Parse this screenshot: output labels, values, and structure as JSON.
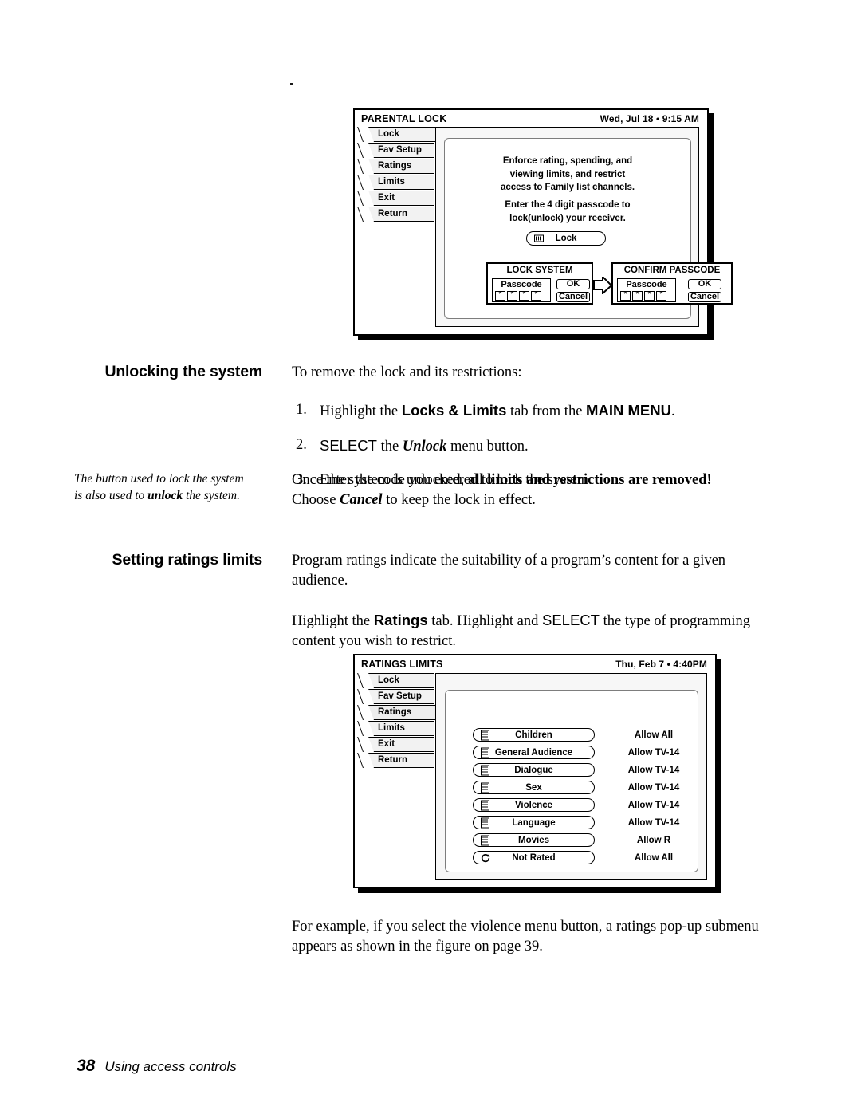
{
  "page": {
    "number": "38",
    "footer_text": "Using access controls"
  },
  "figure1": {
    "title": "PARENTAL LOCK",
    "clock": "Wed, Jul 18 • 9:15 AM",
    "tabs": [
      {
        "label": "Lock"
      },
      {
        "label": "Fav Setup"
      },
      {
        "label": "Ratings"
      },
      {
        "label": "Limits"
      },
      {
        "label": "Exit"
      },
      {
        "label": "Return"
      }
    ],
    "body_lines_1": [
      "Enforce rating, spending, and",
      "viewing limits, and restrict",
      "access to Family list channels."
    ],
    "body_lines_2": [
      "Enter the 4 digit passcode to",
      "lock(unlock) your receiver."
    ],
    "lock_button": {
      "label": "Lock",
      "icon": "bars-icon"
    },
    "dialog_lock": {
      "title": "LOCK SYSTEM",
      "passcode_label": "Passcode",
      "digits": [
        "*",
        "*",
        "*",
        "*"
      ],
      "ok_label": "OK",
      "cancel_label": "Cancel"
    },
    "dialog_confirm": {
      "title": "CONFIRM PASSCODE",
      "passcode_label": "Passcode",
      "digits": [
        "*",
        "*",
        "*",
        "*"
      ],
      "ok_label": "OK",
      "cancel_label": "Cancel"
    }
  },
  "section_unlock": {
    "heading": "Unlocking the system",
    "intro": "To remove the lock and its restrictions:",
    "steps": [
      {
        "num": "1.",
        "parts": [
          {
            "t": "Highlight the ",
            "s": "serif"
          },
          {
            "t": "Locks & Limits",
            "s": "sans-bold"
          },
          {
            "t": " tab from the ",
            "s": "serif"
          },
          {
            "t": "MAIN MENU",
            "s": "sans-bold"
          },
          {
            "t": ".",
            "s": "serif"
          }
        ]
      },
      {
        "num": "2.",
        "parts": [
          {
            "t": "SELECT",
            "s": "sans"
          },
          {
            "t": " the ",
            "s": "serif"
          },
          {
            "t": "Unlock",
            "s": "serif-bold-italic"
          },
          {
            "t": " menu button.",
            "s": "serif"
          }
        ]
      },
      {
        "num": "3.",
        "parts": [
          {
            "t": "Enter the code you entered to lock the system.",
            "s": "serif"
          }
        ]
      }
    ],
    "margin_note_line1": "The button used to lock the system",
    "margin_note_line2_a": "is also used to ",
    "margin_note_line2_b": "unlock",
    "margin_note_line2_c": " the system.",
    "outcome_a": "Once the system is unlocked, ",
    "outcome_b": "all limits and restrictions are removed!",
    "outcome_c": "Choose ",
    "outcome_d": "Cancel",
    "outcome_e": " to keep the lock in effect."
  },
  "section_ratings": {
    "heading": "Setting ratings limits",
    "para1_line1": "Program ratings indicate the suitability of a program’s content for a given",
    "para1_line2": "audience.",
    "para2_a": "Highlight the ",
    "para2_b": "Ratings",
    "para2_c": " tab. Highlight and ",
    "para2_d": "SELECT",
    "para2_e": " the type of programming",
    "para2_f": "content you wish to restrict."
  },
  "figure2": {
    "title": "RATINGS LIMITS",
    "clock": "Thu, Feb 7 •  4:40PM",
    "tabs": [
      {
        "label": "Lock",
        "selected": false
      },
      {
        "label": "Fav Setup",
        "selected": false
      },
      {
        "label": "Ratings",
        "selected": true
      },
      {
        "label": "Limits",
        "selected": false
      },
      {
        "label": "Exit",
        "selected": false
      },
      {
        "label": "Return",
        "selected": false
      }
    ],
    "rows": [
      {
        "label": "Children",
        "value": "Allow All",
        "icon": "list-icon"
      },
      {
        "label": "General Audience",
        "value": "Allow TV-14",
        "icon": "list-icon"
      },
      {
        "label": "Dialogue",
        "value": "Allow TV-14",
        "icon": "list-icon"
      },
      {
        "label": "Sex",
        "value": "Allow TV-14",
        "icon": "list-icon"
      },
      {
        "label": "Violence",
        "value": "Allow TV-14",
        "icon": "list-icon"
      },
      {
        "label": "Language",
        "value": "Allow TV-14",
        "icon": "list-icon"
      },
      {
        "label": "Movies",
        "value": "Allow R",
        "icon": "list-icon"
      },
      {
        "label": "Not Rated",
        "value": "Allow All",
        "icon": "circular-arrow-icon"
      }
    ]
  },
  "closing": {
    "line1": "For example, if you select the violence menu button, a ratings pop-up submenu",
    "line2": "appears as shown in the figure on page 39."
  }
}
